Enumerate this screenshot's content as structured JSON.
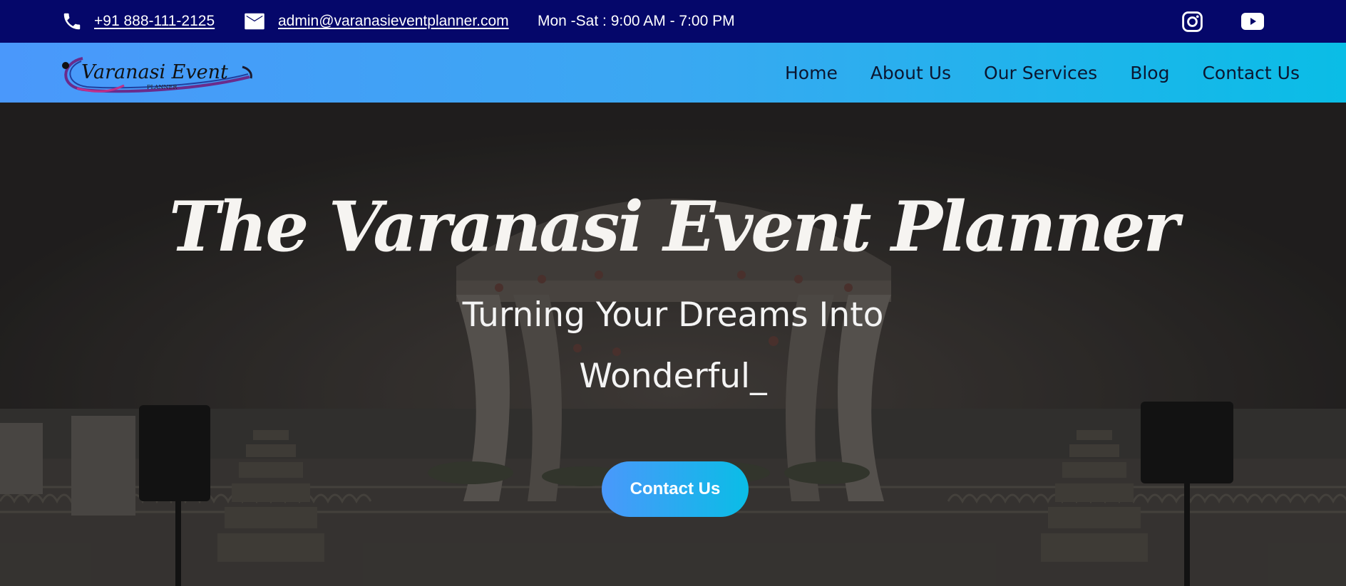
{
  "topbar": {
    "phone": "+91 888-111-2125",
    "email": "admin@varanasieventplanner.com",
    "hours": "Mon -Sat : 9:00 AM - 7:00 PM",
    "icons": [
      "phone-icon",
      "mail-icon",
      "instagram-icon",
      "youtube-icon"
    ]
  },
  "brand": {
    "logo_text": "Varanasi Event",
    "logo_subtext": "PLANNER"
  },
  "nav": {
    "items": [
      "Home",
      "About Us",
      "Our Services",
      "Blog",
      "Contact Us"
    ]
  },
  "hero": {
    "title": "The Varanasi Event Planner",
    "subtitle_line1": "Turning Your Dreams Into",
    "subtitle_line2": "Wonderful_",
    "cta_label": "Contact Us"
  },
  "colors": {
    "topbar_bg": "#05076a",
    "nav_gradient_start": "#4a98fb",
    "nav_gradient_end": "#0abde6",
    "hero_text": "#f6f4f1"
  }
}
